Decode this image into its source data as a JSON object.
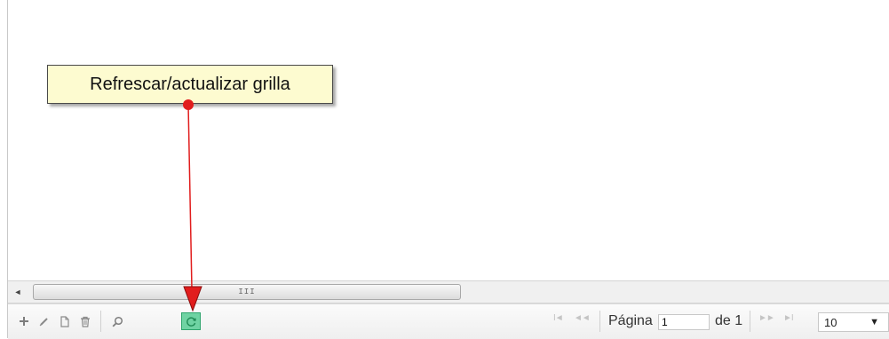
{
  "tooltip": {
    "text": "Refrescar/actualizar grilla"
  },
  "scrollbar": {
    "left_arrow": "◄",
    "grip": "III"
  },
  "pager": {
    "page_label": "Página",
    "page_value": "1",
    "of_label": "de 1",
    "rows_per_page": "10",
    "rows_caret": "▼",
    "nav_first": "I◄",
    "nav_prev": "◄◄",
    "nav_next": "►►",
    "nav_last": "►I"
  },
  "toolbar_icons": [
    "plus-icon",
    "pencil-icon",
    "document-icon",
    "trash-icon",
    "search-icon",
    "refresh-icon"
  ],
  "colors": {
    "refresh_highlight": "#6fd3a3",
    "annotation_arrow": "#e11d1d",
    "tooltip_bg": "#fdfbd0"
  }
}
